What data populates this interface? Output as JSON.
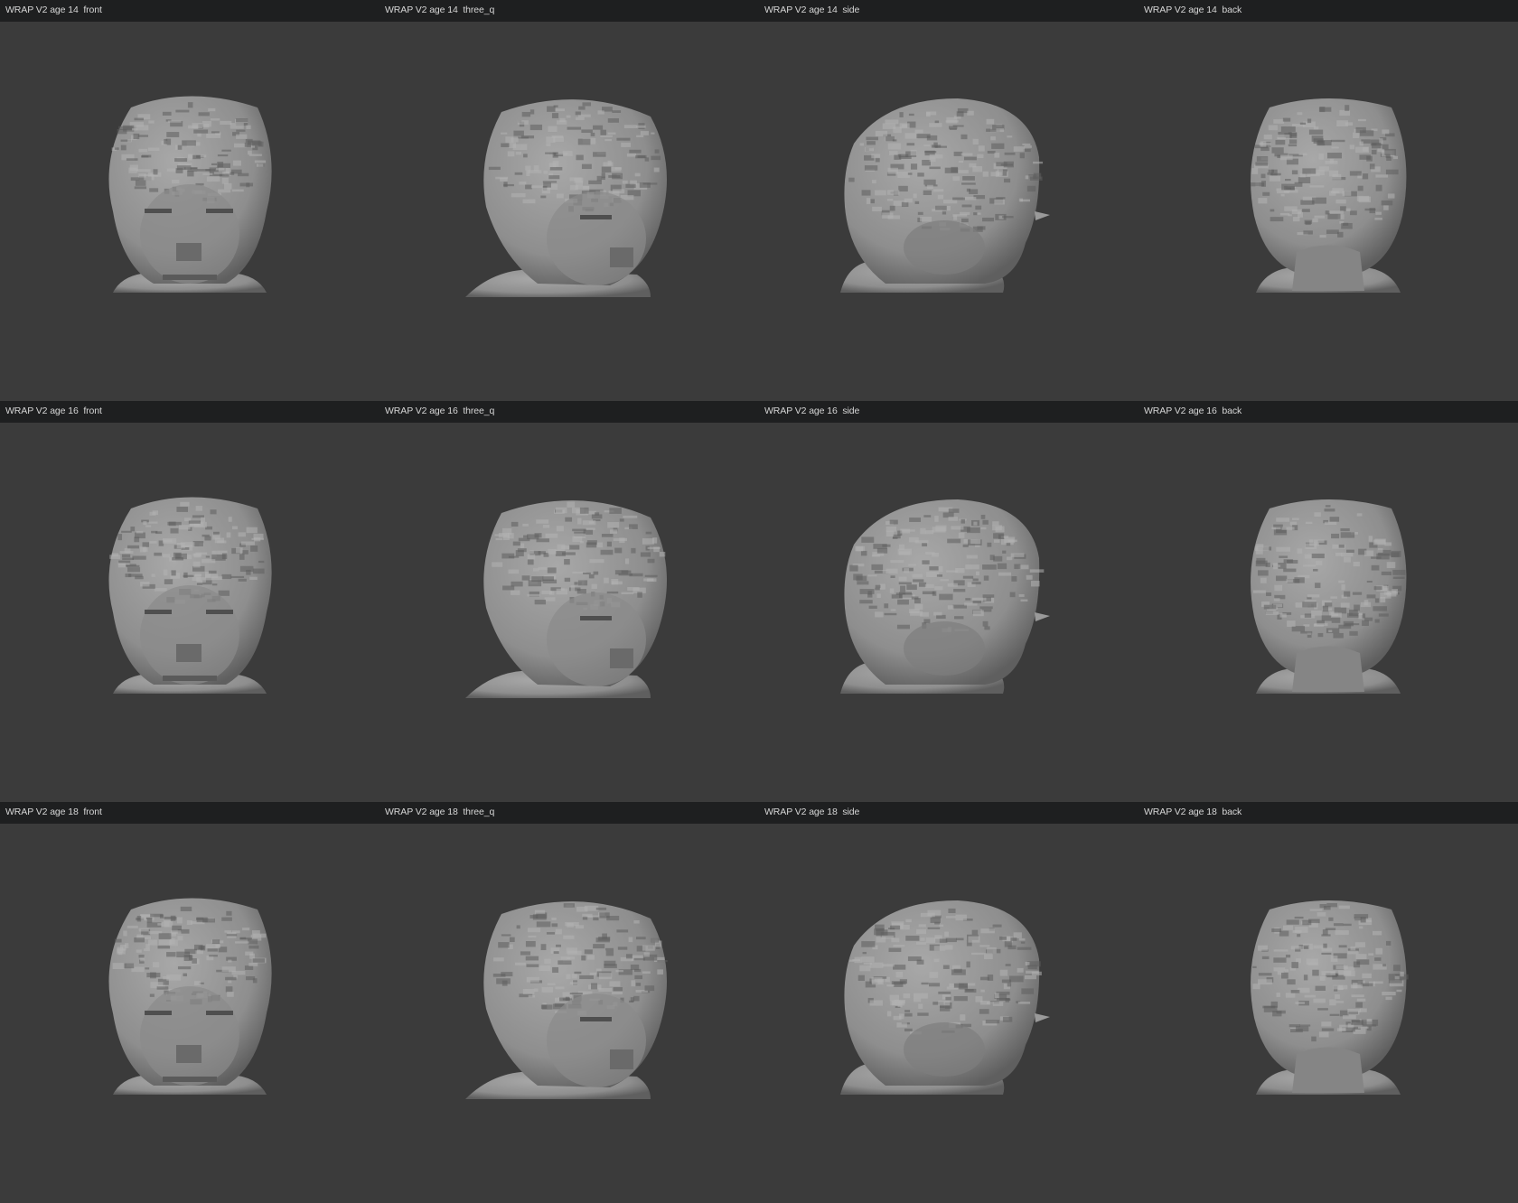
{
  "window": {
    "background": "#3b3b3b",
    "header_color": "#1e1f20",
    "mesh_color": "#8e8e8e"
  },
  "rows": [
    {
      "age_label": "age 14",
      "cells": [
        {
          "label": "WRAP V2 age 14  front",
          "view": "front"
        },
        {
          "label": "WRAP V2 age 14  three_q",
          "view": "three_q"
        },
        {
          "label": "WRAP V2 age 14  side",
          "view": "side"
        },
        {
          "label": "WRAP V2 age 14  back",
          "view": "back"
        }
      ]
    },
    {
      "age_label": "age 16",
      "cells": [
        {
          "label": "WRAP V2 age 16  front",
          "view": "front"
        },
        {
          "label": "WRAP V2 age 16  three_q",
          "view": "three_q"
        },
        {
          "label": "WRAP V2 age 16  side",
          "view": "side"
        },
        {
          "label": "WRAP V2 age 16  back",
          "view": "back"
        }
      ]
    },
    {
      "age_label": "age 18",
      "cells": [
        {
          "label": "WRAP V2 age 18  front",
          "view": "front"
        },
        {
          "label": "WRAP V2 age 18  three_q",
          "view": "three_q"
        },
        {
          "label": "WRAP V2 age 18  side",
          "view": "side"
        },
        {
          "label": "WRAP V2 age 18  back",
          "view": "back"
        }
      ]
    }
  ]
}
